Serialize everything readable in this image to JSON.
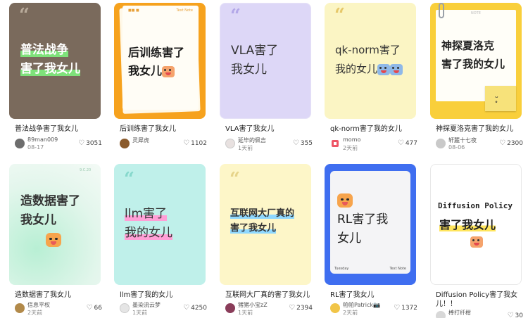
{
  "cards": [
    {
      "title": "普法战争害了我女儿",
      "cover": "普法战争\n害了我女儿",
      "author": "89man009",
      "date": "08-17",
      "likes": "3051"
    },
    {
      "title": "后训练害了我女儿",
      "cover": "后训练害了\n我女儿",
      "author": "灵犀虎",
      "date": "",
      "likes": "1102"
    },
    {
      "title": "VLA害了我女儿",
      "cover": "VLA害了\n我女儿",
      "author": "延毕的佩吉",
      "date": "1天前",
      "likes": "355"
    },
    {
      "title": "qk-norm害了我的女儿",
      "cover": "qk-norm害了\n我的女儿",
      "author": "momo",
      "date": "2天前",
      "likes": "477"
    },
    {
      "title": "神探夏洛克害了我的女儿",
      "cover": "神探夏洛克\n害了我的女儿",
      "author": "轩麓十七夜",
      "date": "08-06",
      "likes": "2300"
    },
    {
      "title": "造数据害了我女儿",
      "cover": "造数据害了\n我女儿",
      "author": "信息平权",
      "date": "2天前",
      "likes": "66"
    },
    {
      "title": "llm害了我的女儿",
      "cover": "llm害了\n我的女儿",
      "author": "墨染流云梦",
      "date": "1天前",
      "likes": "4250"
    },
    {
      "title": "互联网大厂真的害了我女儿",
      "cover": "互联网大厂真的\n害了我女儿",
      "author": "猪猪小宝zZ",
      "date": "1天前",
      "likes": "2394"
    },
    {
      "title": "RL害了我女儿",
      "cover": "RL害了我\n女儿",
      "author": "帕帕Patrick📷",
      "date": "2天前",
      "likes": "1372"
    },
    {
      "title": "Diffusion Policy害了我女",
      "title2": "儿！！",
      "cover_top": "Diffusion Policy",
      "cover_bottom": "害了我女儿",
      "author": "棒打纤柑",
      "date": "",
      "likes": "30"
    }
  ],
  "cover_small": {
    "card2_left": "■■ ■",
    "card2_right": "Text Note",
    "card5_top": "NOTE",
    "card6_top": "9.C.20",
    "card9_left": "Tuesday",
    "card9_right": "Text Note"
  },
  "colors": {
    "card1_bg": "#7a6a5c",
    "card2_bg": "#f6a21e",
    "card3_bg": "#ddd7f7",
    "card4_bg": "#fbf5c4",
    "card5_bg": "#f9cf3b",
    "card6_bg": "#d6f2e6",
    "card7_bg": "#bff0ea",
    "card8_bg": "#fdf6c8",
    "card9_bg": "#3f6ef0",
    "card10_bg": "#ffffff"
  },
  "icons": {
    "like": "heart-outline-icon",
    "quote": "quote-icon"
  }
}
